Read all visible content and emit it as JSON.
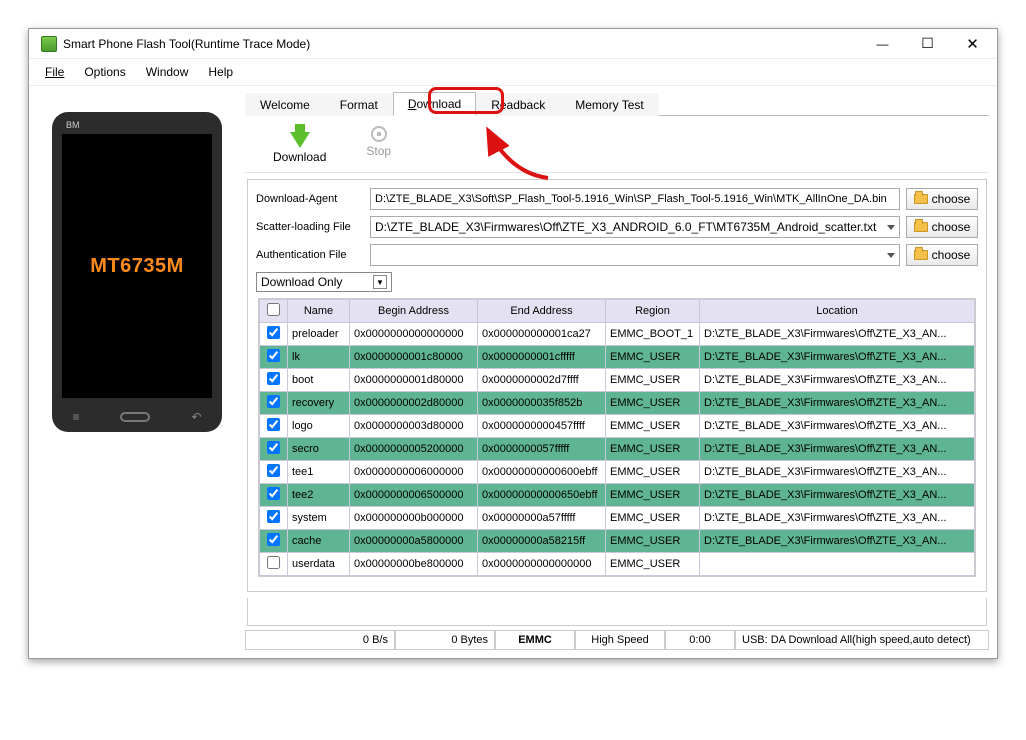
{
  "window": {
    "title": "Smart Phone Flash Tool(Runtime Trace Mode)"
  },
  "menu": {
    "file": "File",
    "options": "Options",
    "window": "Window",
    "help": "Help"
  },
  "phone": {
    "brand": "BM",
    "chip": "MT6735M"
  },
  "tabs": {
    "welcome": "Welcome",
    "format": "Format",
    "download": "Download",
    "readback": "Readback",
    "memtest": "Memory Test"
  },
  "toolbar": {
    "download": "Download",
    "stop": "Stop"
  },
  "files": {
    "da_label": "Download-Agent",
    "da_path": "D:\\ZTE_BLADE_X3\\Soft\\SP_Flash_Tool-5.1916_Win\\SP_Flash_Tool-5.1916_Win\\MTK_AllInOne_DA.bin",
    "scatter_label": "Scatter-loading File",
    "scatter_path": "D:\\ZTE_BLADE_X3\\Firmwares\\Off\\ZTE_X3_ANDROID_6.0_FT\\MT6735M_Android_scatter.txt",
    "auth_label": "Authentication File",
    "auth_path": "",
    "choose": "choose",
    "mode": "Download Only"
  },
  "table": {
    "headers": {
      "name": "Name",
      "begin": "Begin Address",
      "end": "End Address",
      "region": "Region",
      "location": "Location"
    },
    "rows": [
      {
        "chk": true,
        "g": false,
        "name": "preloader",
        "b": "0x0000000000000000",
        "e": "0x000000000001ca27",
        "r": "EMMC_BOOT_1",
        "l": "D:\\ZTE_BLADE_X3\\Firmwares\\Off\\ZTE_X3_AN..."
      },
      {
        "chk": true,
        "g": true,
        "name": "lk",
        "b": "0x0000000001c80000",
        "e": "0x0000000001cfffff",
        "r": "EMMC_USER",
        "l": "D:\\ZTE_BLADE_X3\\Firmwares\\Off\\ZTE_X3_AN..."
      },
      {
        "chk": true,
        "g": false,
        "name": "boot",
        "b": "0x0000000001d80000",
        "e": "0x0000000002d7ffff",
        "r": "EMMC_USER",
        "l": "D:\\ZTE_BLADE_X3\\Firmwares\\Off\\ZTE_X3_AN..."
      },
      {
        "chk": true,
        "g": true,
        "name": "recovery",
        "b": "0x0000000002d80000",
        "e": "0x0000000035f852b",
        "r": "EMMC_USER",
        "l": "D:\\ZTE_BLADE_X3\\Firmwares\\Off\\ZTE_X3_AN..."
      },
      {
        "chk": true,
        "g": false,
        "name": "logo",
        "b": "0x0000000003d80000",
        "e": "0x0000000000457ffff",
        "r": "EMMC_USER",
        "l": "D:\\ZTE_BLADE_X3\\Firmwares\\Off\\ZTE_X3_AN..."
      },
      {
        "chk": true,
        "g": true,
        "name": "secro",
        "b": "0x0000000005200000",
        "e": "0x0000000057fffff",
        "r": "EMMC_USER",
        "l": "D:\\ZTE_BLADE_X3\\Firmwares\\Off\\ZTE_X3_AN..."
      },
      {
        "chk": true,
        "g": false,
        "name": "tee1",
        "b": "0x0000000006000000",
        "e": "0x00000000000600ebff",
        "r": "EMMC_USER",
        "l": "D:\\ZTE_BLADE_X3\\Firmwares\\Off\\ZTE_X3_AN..."
      },
      {
        "chk": true,
        "g": true,
        "name": "tee2",
        "b": "0x0000000006500000",
        "e": "0x00000000000650ebff",
        "r": "EMMC_USER",
        "l": "D:\\ZTE_BLADE_X3\\Firmwares\\Off\\ZTE_X3_AN..."
      },
      {
        "chk": true,
        "g": false,
        "name": "system",
        "b": "0x000000000b000000",
        "e": "0x00000000a57fffff",
        "r": "EMMC_USER",
        "l": "D:\\ZTE_BLADE_X3\\Firmwares\\Off\\ZTE_X3_AN..."
      },
      {
        "chk": true,
        "g": true,
        "name": "cache",
        "b": "0x00000000a5800000",
        "e": "0x00000000a58215ff",
        "r": "EMMC_USER",
        "l": "D:\\ZTE_BLADE_X3\\Firmwares\\Off\\ZTE_X3_AN..."
      },
      {
        "chk": false,
        "g": false,
        "name": "userdata",
        "b": "0x00000000be800000",
        "e": "0x0000000000000000",
        "r": "EMMC_USER",
        "l": ""
      }
    ]
  },
  "status": {
    "bps": "0 B/s",
    "bytes": "0 Bytes",
    "storage": "EMMC",
    "speed": "High Speed",
    "time": "0:00",
    "usb": "USB: DA Download All(high speed,auto detect)"
  }
}
